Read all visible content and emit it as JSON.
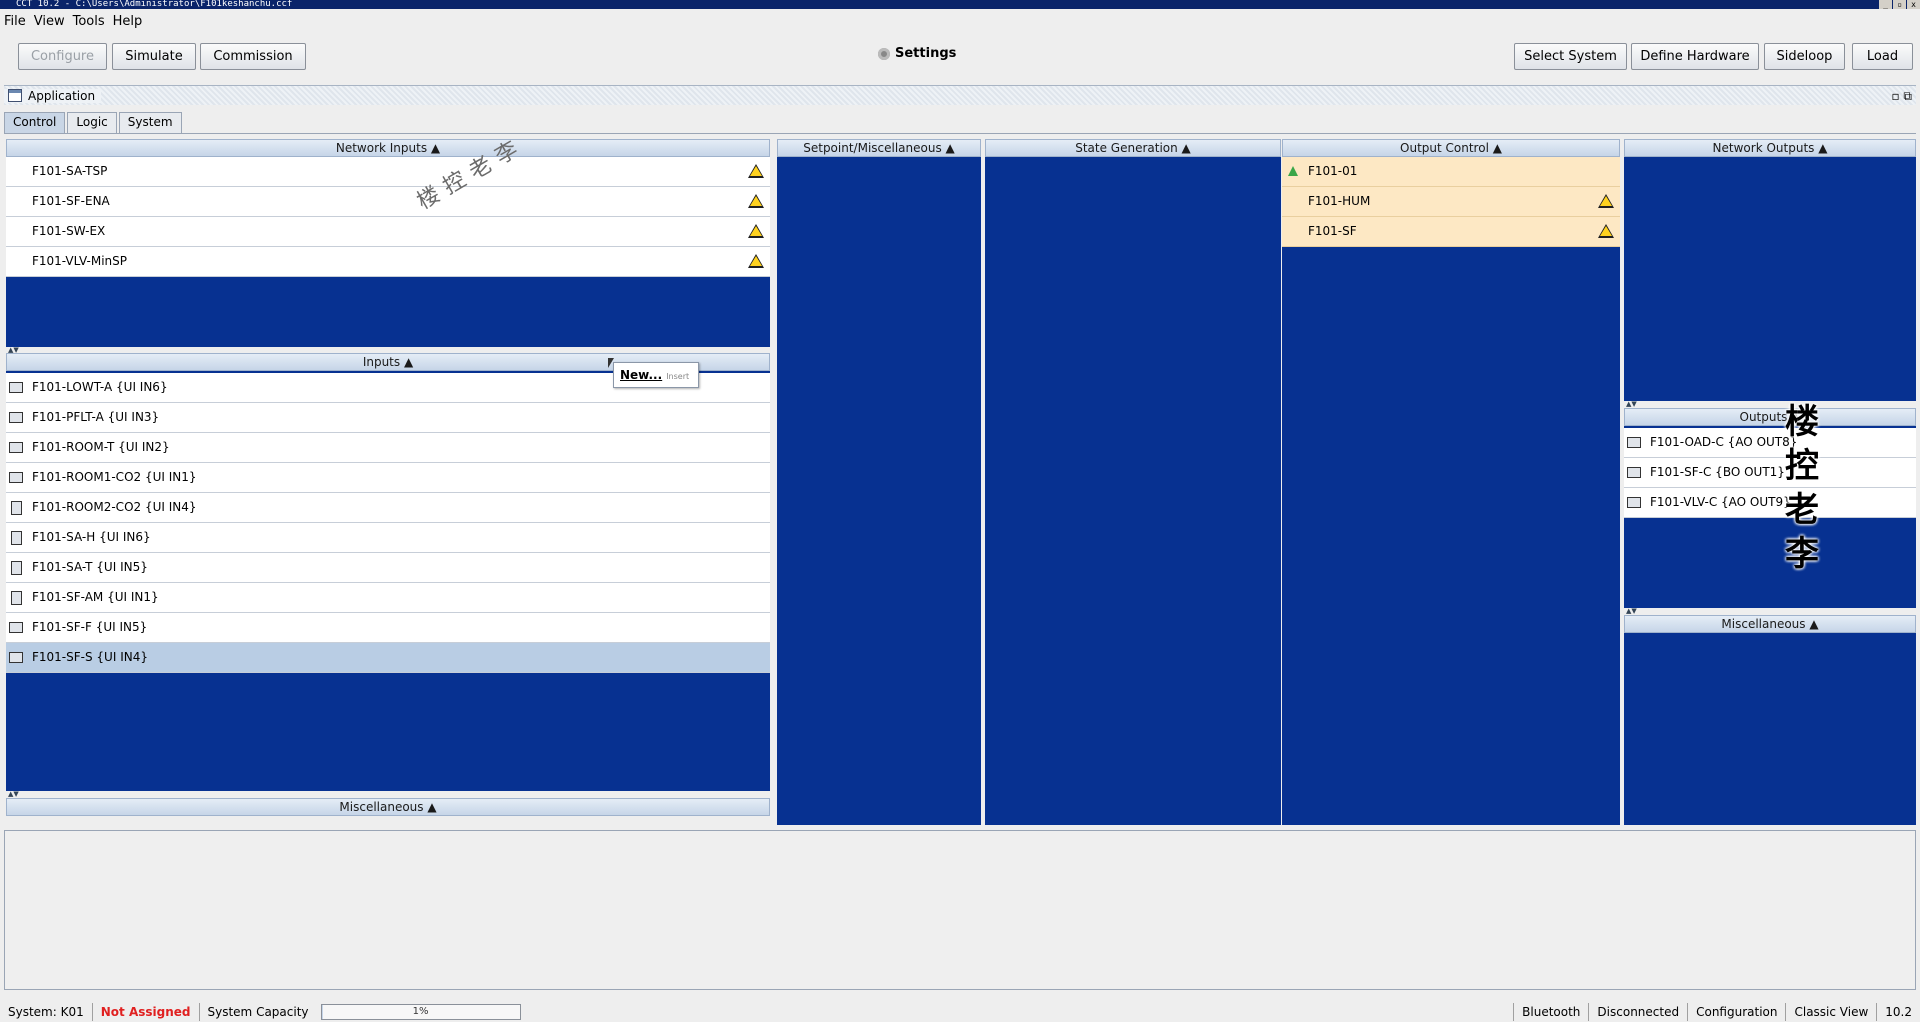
{
  "window": {
    "title": "CCT 10.2 - C:\\Users\\Administrator\\F101keshanchu.ccf",
    "controls": [
      "_",
      "▫",
      "x"
    ]
  },
  "menu": [
    "File",
    "View",
    "Tools",
    "Help"
  ],
  "toolbar": {
    "configure": "Configure",
    "simulate": "Simulate",
    "commission": "Commission",
    "settings": "Settings",
    "select_system": "Select System",
    "define_hardware": "Define Hardware",
    "sideloop": "Sideloop",
    "load": "Load"
  },
  "app_panel": {
    "title": "Application",
    "right_icons": "▫ ⧉"
  },
  "tabs": [
    "Control",
    "Logic",
    "System"
  ],
  "sections": {
    "network_inputs": {
      "title": "Network Inputs ▲",
      "items": [
        "F101-SA-TSP",
        "F101-SF-ENA",
        "F101-SW-EX",
        "F101-VLV-MinSP"
      ]
    },
    "inputs": {
      "title": "Inputs ▲",
      "items": [
        "F101-LOWT-A {UI IN6}",
        "F101-PFLT-A {UI IN3}",
        "F101-ROOM-T {UI IN2}",
        "F101-ROOM1-CO2 {UI IN1}",
        "F101-ROOM2-CO2 {UI IN4}",
        "F101-SA-H {UI IN6}",
        "F101-SA-T {UI IN5}",
        "F101-SF-AM {UI IN1}",
        "F101-SF-F {UI IN5}",
        "F101-SF-S {UI IN4}"
      ]
    },
    "misc_left": {
      "title": "Miscellaneous ▲"
    },
    "setpoint": {
      "title": "Setpoint/Miscellaneous ▲"
    },
    "state_gen": {
      "title": "State Generation ▲"
    },
    "output_control": {
      "title": "Output Control ▲",
      "items": [
        "F101-01",
        "F101-HUM",
        "F101-SF"
      ]
    },
    "network_outputs": {
      "title": "Network Outputs ▲"
    },
    "outputs": {
      "title": "Outputs ▲",
      "items": [
        "F101-OAD-C {AO OUT8}",
        "F101-SF-C {BO OUT1}",
        "F101-VLV-C {AO OUT9}"
      ]
    },
    "misc_right": {
      "title": "Miscellaneous ▲"
    }
  },
  "context_menu": {
    "new": "New...",
    "hint": "Insert"
  },
  "watermark": {
    "text1": "楼控老李",
    "text2": [
      "楼",
      "控",
      "老",
      "李"
    ]
  },
  "status": {
    "system": "System: K01",
    "not_assigned": "Not Assigned",
    "capacity_label": "System Capacity",
    "capacity_value": "1%",
    "capacity_fraction": 0.01,
    "bluetooth": "Bluetooth",
    "disconnected": "Disconnected",
    "configuration": "Configuration",
    "classic_view": "Classic View",
    "version": "10.2"
  }
}
